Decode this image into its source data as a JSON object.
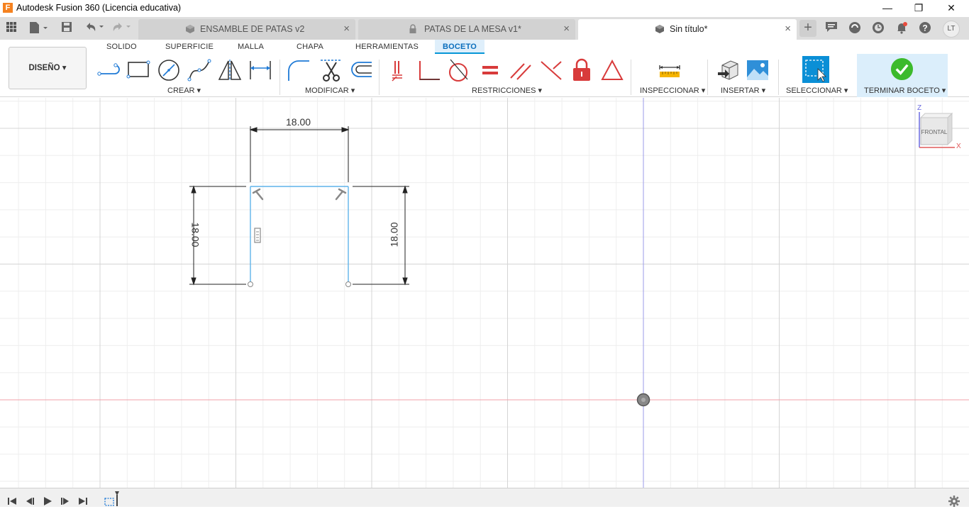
{
  "window": {
    "title": "Autodesk Fusion 360 (Licencia educativa)",
    "minimize": "—",
    "restore": "❐",
    "close": "✕"
  },
  "tabs": [
    {
      "label": "ENSAMBLE DE PATAS v2",
      "icon": "component-cube-icon",
      "close": "×"
    },
    {
      "label": "PATAS DE LA MESA v1*",
      "icon": "lock-icon",
      "close": "×"
    },
    {
      "label": "Sin título*",
      "icon": "component-cube-icon",
      "close": "×",
      "active": true
    }
  ],
  "user_initials": "LT",
  "workspace": {
    "label": "DISEÑO ▾"
  },
  "ribbon_tabs": [
    "SOLIDO",
    "SUPERFICIE",
    "MALLA",
    "CHAPA",
    "HERRAMIENTAS",
    "BOCETO"
  ],
  "active_ribbon_tab": "BOCETO",
  "groups": {
    "crear": "CREAR ▾",
    "modificar": "MODIFICAR ▾",
    "restricciones": "RESTRICCIONES ▾",
    "inspeccionar": "INSPECCIONAR ▾",
    "insertar": "INSERTAR ▾",
    "seleccionar": "SELECCIONAR ▾",
    "terminar": "TERMINAR BOCETO ▾"
  },
  "sketch": {
    "dim_top": "18.00",
    "dim_left": "18.00",
    "dim_right": "18.00"
  },
  "viewcube": {
    "face": "FRONTAL",
    "axis_z": "Z",
    "axis_x": "X"
  },
  "colors": {
    "accent": "#0696d7",
    "sketch_line": "#5fb3ea",
    "constraint_red": "#d83b3b",
    "finish_green": "#3cba2c",
    "origin_red_axis": "#f0a0a8",
    "origin_blue_axis": "#9b9be8"
  }
}
